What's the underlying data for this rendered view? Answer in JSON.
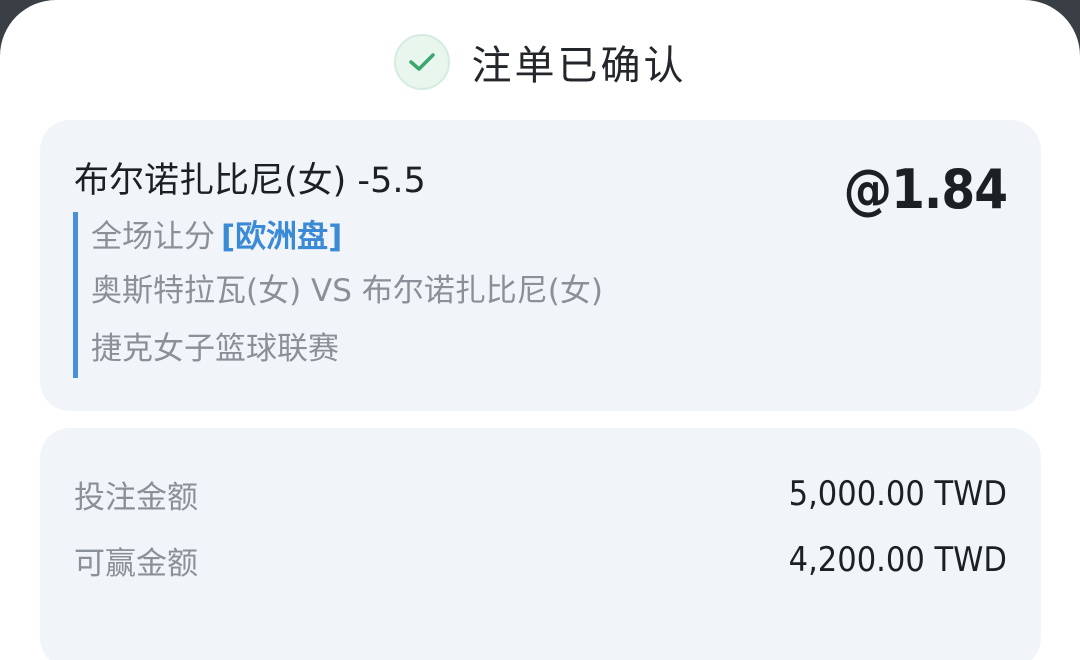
{
  "header": {
    "title": "注单已确认",
    "icon": "check-icon",
    "icon_color": "#3aa76d"
  },
  "bet": {
    "selection": "布尔诺扎比尼(女) -5.5",
    "odds": "@1.84",
    "market": "全场让分",
    "market_tag": "[欧洲盘]",
    "match": "奥斯特拉瓦(女) VS 布尔诺扎比尼(女)",
    "league": "捷克女子篮球联赛",
    "accent_color": "#4a90d9"
  },
  "amounts": {
    "stake_label": "投注金额",
    "stake_value": "5,000.00 TWD",
    "win_label": "可赢金额",
    "win_value": "4,200.00 TWD"
  }
}
